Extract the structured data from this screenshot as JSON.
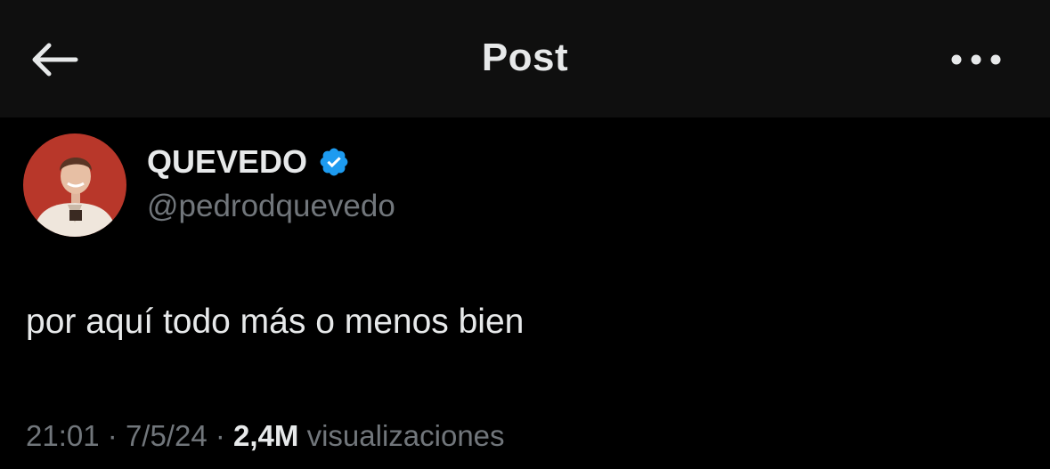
{
  "header": {
    "title": "Post",
    "back_icon": "arrow-left-icon",
    "more_icon": "more-horizontal-icon"
  },
  "author": {
    "display_name": "QUEVEDO",
    "handle": "@pedrodquevedo",
    "verified": true,
    "verified_color": "#1d9bf0",
    "avatar_background": "#b8372a"
  },
  "post": {
    "text": "por aquí todo más o menos bien"
  },
  "meta": {
    "time": "21:01",
    "separator": "·",
    "date": "7/5/24",
    "views_count": "2,4M",
    "views_label": "visualizaciones"
  },
  "colors": {
    "background": "#000000",
    "header_background": "#0f0f0f",
    "primary_text": "#e7e9ea",
    "secondary_text": "#71767b"
  }
}
